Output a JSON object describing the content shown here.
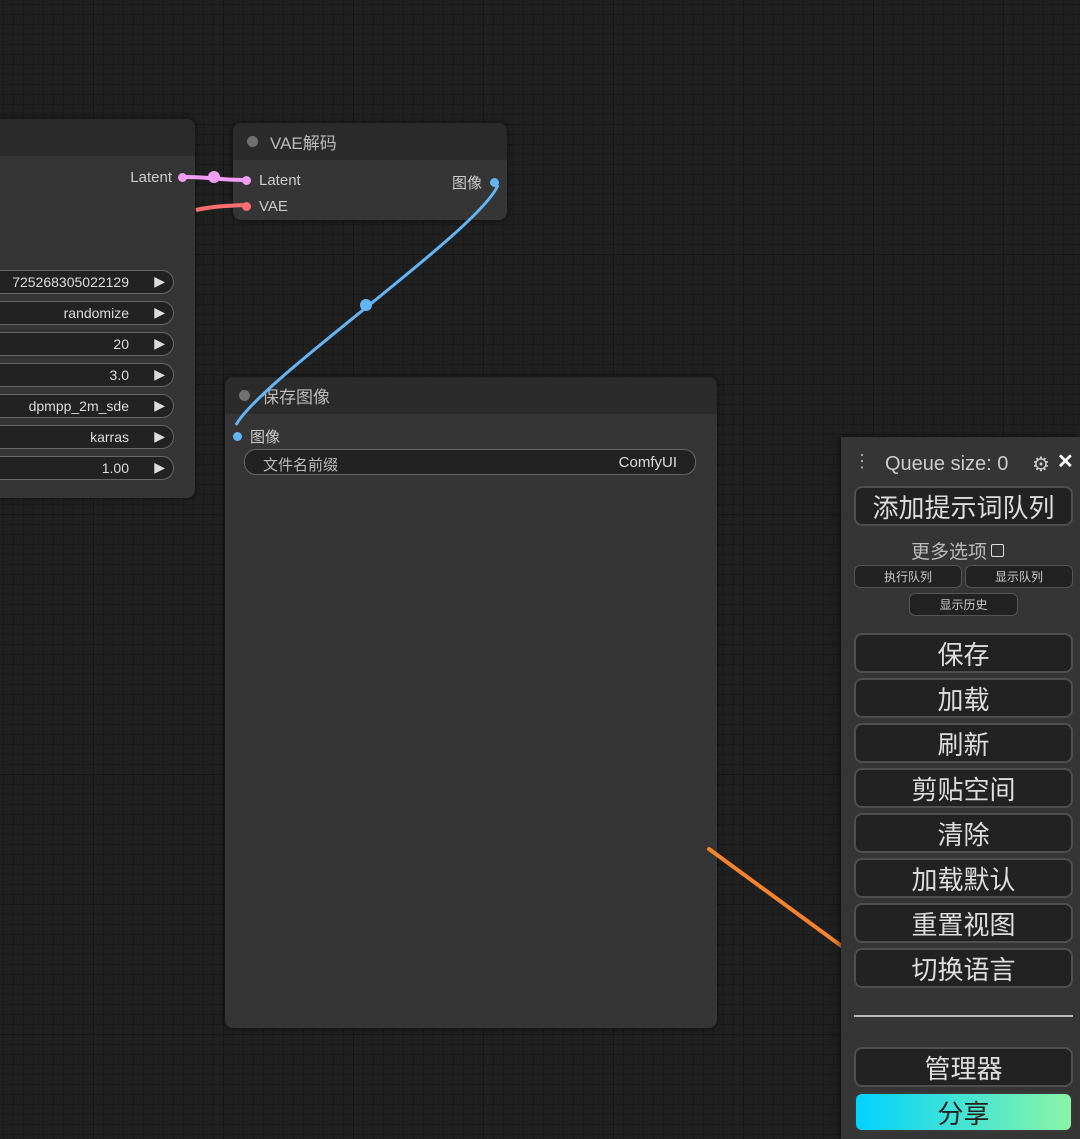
{
  "node_ksampler": {
    "outputs": [
      {
        "label": "Latent",
        "color": "#f29ef5"
      }
    ],
    "widgets": [
      {
        "value": "725268305022129"
      },
      {
        "value": "randomize"
      },
      {
        "value": "20"
      },
      {
        "value": "3.0"
      },
      {
        "value": "dpmpp_2m_sde"
      },
      {
        "value": "karras"
      },
      {
        "value": "1.00"
      }
    ]
  },
  "node_vae_decode": {
    "title": "VAE解码",
    "inputs": [
      {
        "label": "Latent",
        "color": "#f29ef5"
      },
      {
        "label": "VAE",
        "color": "#ff6e6e"
      }
    ],
    "output": {
      "label": "图像",
      "color": "#64b5f6"
    }
  },
  "node_save_image": {
    "title": "保存图像",
    "input": {
      "label": "图像",
      "color": "#64b5f6"
    },
    "widget": {
      "label": "文件名前缀",
      "value": "ComfyUI"
    }
  },
  "queue_panel": {
    "drag_icon": "drag-handle-icon",
    "queue_size": "Queue size: 0",
    "gear_icon": "gear-icon",
    "close_icon": "close-icon",
    "queue_prompt": "添加提示词队列",
    "more_options": "更多选项",
    "view_queue_exec": "执行队列",
    "view_queue": "显示队列",
    "view_history": "显示历史",
    "buttons": [
      "保存",
      "加载",
      "刷新",
      "剪贴空间",
      "清除",
      "加载默认",
      "重置视图",
      "切换语言"
    ],
    "manager": "管理器",
    "share": "分享"
  },
  "annotation": {
    "color": "#f5842c",
    "icon": "arrow-annotation"
  },
  "wire_colors": {
    "latent": "#f29ef5",
    "vae": "#ff6e6e",
    "image": "#64b5f6"
  }
}
